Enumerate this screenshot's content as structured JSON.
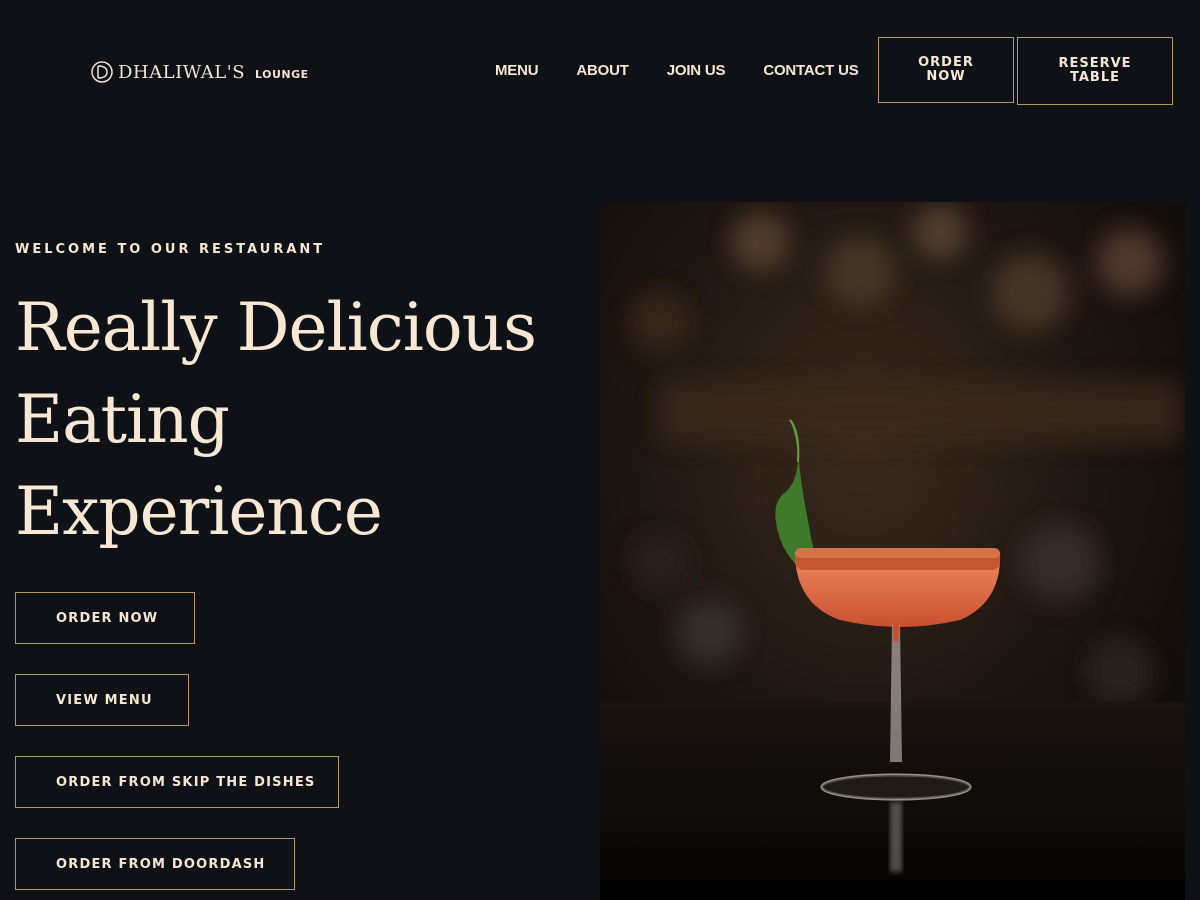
{
  "brand": {
    "name": "DHALIWAL'S",
    "sub": "LOUNGE"
  },
  "nav": {
    "items": [
      "MENU",
      "ABOUT",
      "JOIN US",
      "CONTACT US"
    ]
  },
  "header_buttons": {
    "order_line1": "ORDER",
    "order_line2": "NOW",
    "reserve_line1": "RESERVE",
    "reserve_line2": "TABLE"
  },
  "hero": {
    "eyebrow": "WELCOME TO OUR RESTAURANT",
    "headline_line1": "Really Delicious",
    "headline_line2": "Eating",
    "headline_line3": "Experience",
    "buttons": [
      "ORDER NOW",
      "VIEW MENU",
      "ORDER FROM SKIP THE DISHES",
      "ORDER FROM DOORDASH"
    ]
  },
  "colors": {
    "background": "#0e1216",
    "accent_border": "#b89660",
    "text": "#f6e6d2"
  },
  "icons": {
    "logo": "brand-logo-icon"
  }
}
